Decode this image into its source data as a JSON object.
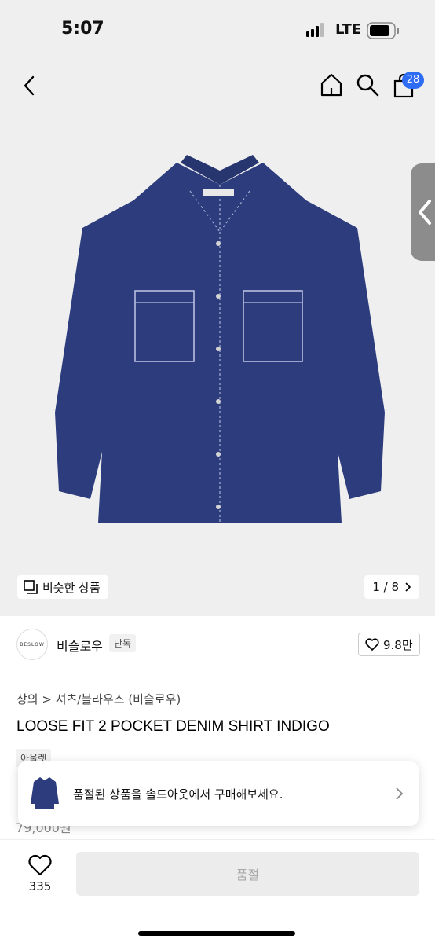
{
  "status_bar": {
    "time": "5:07",
    "network": "LTE"
  },
  "nav": {
    "cart_count": "28"
  },
  "gallery": {
    "similar_label": "비슷한 상품",
    "counter": "1 / 8"
  },
  "brand": {
    "logo_text": "BESLOW",
    "name": "비슬로우",
    "tag": "단독",
    "likes": "9.8만"
  },
  "product": {
    "breadcrumb": "상의 > 셔츠/블라우스 (비슬로우)",
    "title": "LOOSE FIT 2 POCKET DENIM SHIRT INDIGO",
    "outlet_tag": "아울렛",
    "price_partial": "79,000원"
  },
  "toast": {
    "message": "품절된 상품을 솔드아웃에서 구매해보세요."
  },
  "bottom": {
    "like_count": "335",
    "buy_label": "품절"
  },
  "colors": {
    "accent": "#2f6cf6",
    "denim": "#2c3c7c"
  }
}
